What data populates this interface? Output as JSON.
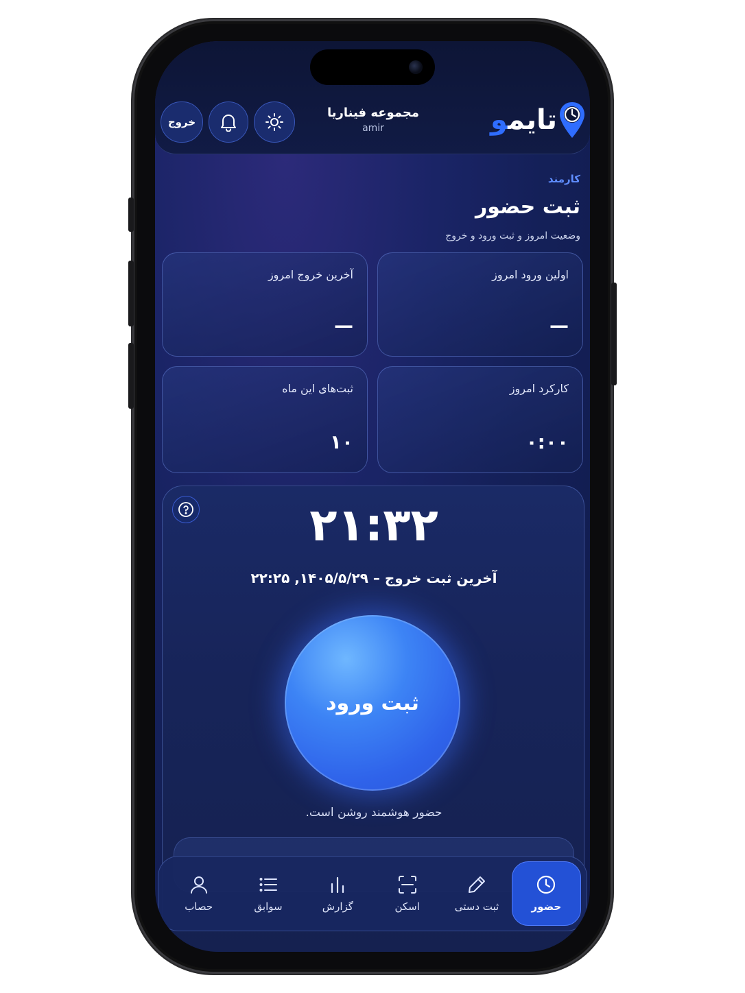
{
  "header": {
    "logo_text": "تایمو",
    "org_name": "مجموعه فیناریا",
    "org_user": "amir",
    "theme_icon": "sun-icon",
    "notification_icon": "bell-icon",
    "exit_label": "خروج"
  },
  "section": {
    "role": "کارمند",
    "title": "ثبت حضور",
    "subtitle": "وضعیت امروز و ثبت ورود و خروج"
  },
  "stats": [
    {
      "label": "اولین ورود امروز",
      "value": "—"
    },
    {
      "label": "آخرین خروج امروز",
      "value": "—"
    },
    {
      "label": "کارکرد امروز",
      "value": "۰:۰۰"
    },
    {
      "label": "ثبت‌های این ماه",
      "value": "۱۰"
    }
  ],
  "clock": {
    "time": "۲۱:۳۲",
    "last_record": "آخرین ثبت خروج – ۱۴۰۵/۵/۲۹, ۲۲:۲۵",
    "checkin_label": "ثبت ورود",
    "smart_status": "حضور هوشمند روشن است.",
    "help_icon": "help-icon"
  },
  "nav": {
    "items": [
      {
        "label": "حضور",
        "icon": "clock-icon",
        "active": true
      },
      {
        "label": "ثبت دستی",
        "icon": "pencil-icon",
        "active": false
      },
      {
        "label": "اسکن",
        "icon": "scan-icon",
        "active": false
      },
      {
        "label": "گزارش",
        "icon": "chart-icon",
        "active": false
      },
      {
        "label": "سوابق",
        "icon": "list-icon",
        "active": false
      },
      {
        "label": "حصاب",
        "icon": "user-icon",
        "active": false
      }
    ]
  },
  "colors": {
    "accent": "#2f6dff",
    "active_nav": "#2351d6",
    "background": "#142058"
  }
}
